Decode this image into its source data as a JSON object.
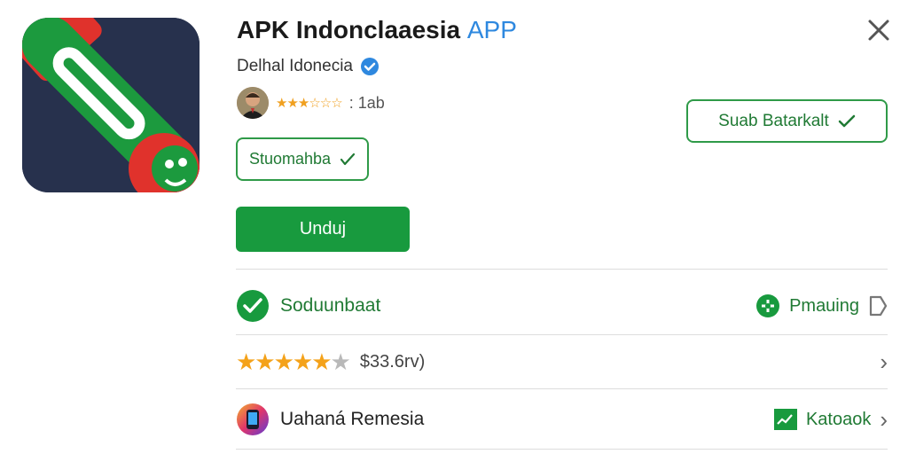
{
  "app": {
    "title_main": "APK Indonclaaesia",
    "title_accent": "APP",
    "developer": "Delhal Idonecia",
    "rating_text": ": 1ab"
  },
  "buttons": {
    "save": "Suab Batarkalt",
    "status": "Stuomahba",
    "download": "Unduj"
  },
  "rows": {
    "security_label": "Soduunbaat",
    "security_action": "Pmauing",
    "review_text": "$33.6rv)",
    "developer_label": "Uahaná Remesia",
    "developer_action": "Katoaok"
  },
  "colors": {
    "accent_green": "#189a3e",
    "link_blue": "#2e88df",
    "star": "#f4a21a"
  }
}
